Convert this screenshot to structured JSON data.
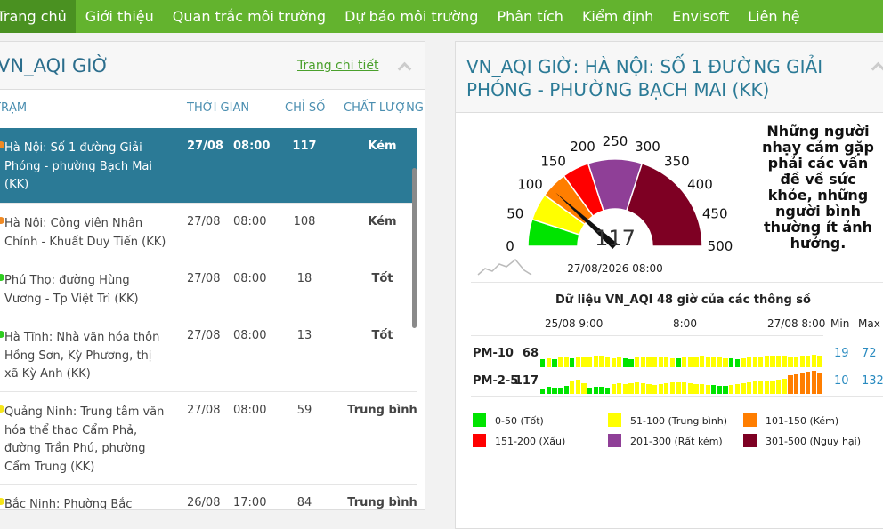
{
  "nav": [
    "Trang chủ",
    "Giới thiệu",
    "Quan trắc môi trường",
    "Dự báo môi trường",
    "Phân tích",
    "Kiểm định",
    "Envisoft",
    "Liên hệ"
  ],
  "left": {
    "title": "VN_AQI GIỜ",
    "detail_link": "Trang chi tiết",
    "col_station": "TRẠM",
    "col_time": "THỜI GIAN",
    "col_index": "CHỈ SỐ",
    "col_quality": "CHẤT LƯỢNG",
    "rows": [
      {
        "station": "Hà Nội: Số 1 đường Giải Phóng - phường Bạch Mai (KK)",
        "date": "27/08",
        "time": "08:00",
        "value": "117",
        "quality": "Kém",
        "color": "#f08a24"
      },
      {
        "station": "Hà Nội: Công viên Nhân Chính - Khuất Duy Tiến (KK)",
        "date": "27/08",
        "time": "08:00",
        "value": "108",
        "quality": "Kém",
        "color": "#f08a24"
      },
      {
        "station": "Phú Thọ: đường Hùng Vương - Tp Việt Trì (KK)",
        "date": "27/08",
        "time": "08:00",
        "value": "18",
        "quality": "Tốt",
        "color": "#2ecc1f"
      },
      {
        "station": "Hà Tĩnh: Nhà văn hóa thôn Hồng Sơn, Kỳ Phương, thị xã Kỳ Anh (KK)",
        "date": "27/08",
        "time": "08:00",
        "value": "13",
        "quality": "Tốt",
        "color": "#2ecc1f"
      },
      {
        "station": "Quảng Ninh: Trung tâm văn hóa thể thao Cẩm Phả, đường Trần Phú, phường Cẩm Trung (KK)",
        "date": "27/08",
        "time": "08:00",
        "value": "59",
        "quality": "Trung bình",
        "color": "#f5e51a"
      },
      {
        "station": "Bắc Ninh: Phường Bắc",
        "date": "26/08",
        "time": "17:00",
        "value": "84",
        "quality": "Trung bình",
        "color": "#f5e51a"
      }
    ]
  },
  "right": {
    "title": "VN_AQI GIỜ: HÀ NỘI: SỐ 1 ĐƯỜNG GIẢI PHÓNG - PHƯỜNG BẠCH MAI (KK)",
    "gauge_value": "117",
    "gauge_time": "27/08/2026 08:00",
    "gauge_ticks": [
      "0",
      "50",
      "100",
      "150",
      "200",
      "250",
      "300",
      "350",
      "400",
      "450",
      "500"
    ],
    "note": "Những người nhạy cảm gặp phải các vấn đề về sức khỏe, những người bình thường ít ảnh hưởng.",
    "bars_title": "Dữ liệu VN_AQI 48 giờ của các thông số",
    "h_start": "25/08 9:00",
    "h_mid": "8:00",
    "h_end": "27/08 8:00",
    "h_min": "Min",
    "h_max": "Max",
    "pm10": {
      "label": "PM-10",
      "value": "68",
      "min": "19",
      "max": "72"
    },
    "pm25": {
      "label": "PM-2-5",
      "value": "117",
      "min": "10",
      "max": "132"
    },
    "legend": [
      {
        "label": "0-50 (Tốt)",
        "color": "#00e400"
      },
      {
        "label": "51-100 (Trung bình)",
        "color": "#ffff00"
      },
      {
        "label": "101-150 (Kém)",
        "color": "#ff7e00"
      },
      {
        "label": "151-200 (Xấu)",
        "color": "#ff0000"
      },
      {
        "label": "201-300 (Rất kém)",
        "color": "#8f3f97"
      },
      {
        "label": "301-500 (Nguy hại)",
        "color": "#7e0023"
      }
    ]
  }
}
